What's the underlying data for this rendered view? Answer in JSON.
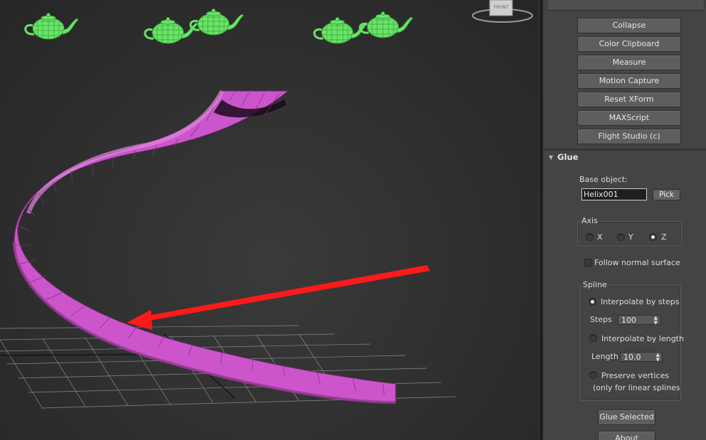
{
  "viewport": {
    "label": "FRONT",
    "colors": {
      "spiral": "#cc55cc",
      "teapot": "#66ee66",
      "arrow": "#ff1a1a",
      "grid": "#8a8a8a"
    }
  },
  "utilities": {
    "buttons": [
      "Collapse",
      "Color Clipboard",
      "Measure",
      "Motion Capture",
      "Reset XForm",
      "MAXScript",
      "Flight Studio (c)"
    ]
  },
  "glue": {
    "title": "Glue",
    "base_object_label": "Base object:",
    "base_object_value": "Helix001",
    "pick_label": "Pick",
    "axis": {
      "title": "Axis",
      "options": [
        "X",
        "Y",
        "Z"
      ],
      "selected": "Z"
    },
    "follow_normal_label": "Follow normal surface",
    "spline": {
      "title": "Spline",
      "interpolate_steps_label": "Interpolate by steps",
      "steps_label": "Steps",
      "steps_value": "100",
      "interpolate_length_label": "Interpolate by length",
      "length_label": "Length",
      "length_value": "10.0",
      "preserve_label": "Preserve vertices",
      "preserve_note": "(only for linear splines"
    },
    "glue_selected_label": "Glue Selected",
    "about_label": "About"
  }
}
